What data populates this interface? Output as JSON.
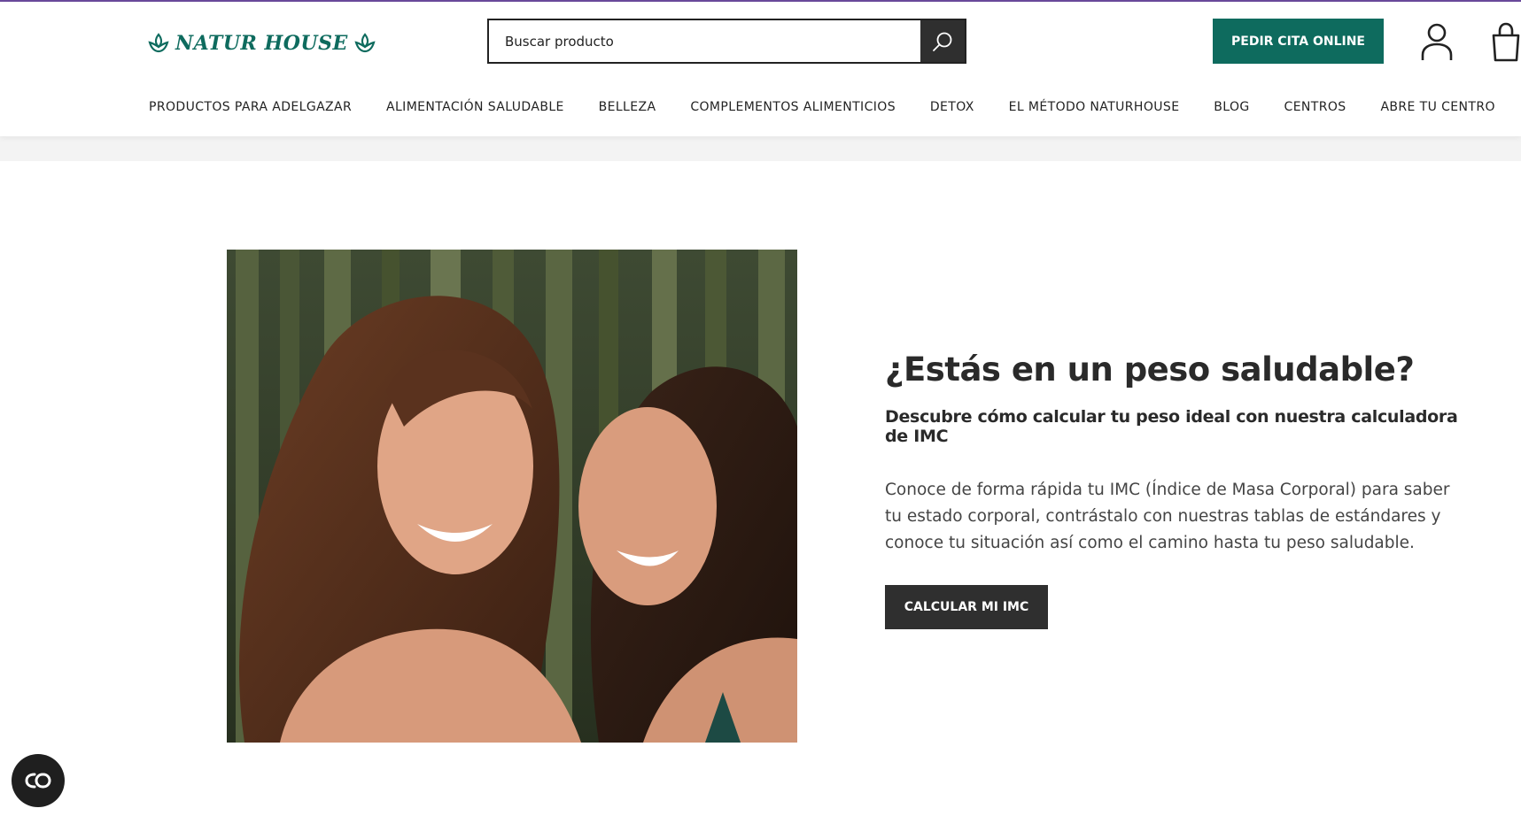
{
  "brand": {
    "logo_text": "NATUR HOUSE",
    "primary_color": "#0e6b5e",
    "dark_color": "#2f2f2f",
    "accent_line_color": "#6a4a9c"
  },
  "header": {
    "search": {
      "placeholder": "Buscar producto",
      "icon": "search-icon"
    },
    "appointment_button": "PEDIR CITA ONLINE",
    "user_icon": "user-icon",
    "cart_icon": "shopping-bag-icon"
  },
  "nav": {
    "items": [
      {
        "label": "PRODUCTOS PARA ADELGAZAR"
      },
      {
        "label": "ALIMENTACIÓN SALUDABLE"
      },
      {
        "label": "BELLEZA"
      },
      {
        "label": "COMPLEMENTOS ALIMENTICIOS"
      },
      {
        "label": "DETOX"
      },
      {
        "label": "EL MÉTODO NATURHOUSE"
      },
      {
        "label": "BLOG"
      },
      {
        "label": "CENTROS"
      },
      {
        "label": "ABRE TU CENTRO"
      }
    ]
  },
  "hero": {
    "title": "¿Estás en un peso saludable?",
    "subtitle": "Descubre cómo calcular tu peso ideal con nuestra calculadora de IMC",
    "body": "Conoce de forma rápida tu IMC (Índice de Masa Corporal) para saber tu estado corporal, contrástalo con nuestras tablas de estándares y conoce tu situación así como el camino hasta tu peso saludable.",
    "button": "CALCULAR MI IMC",
    "image": "two-smiling-women-bamboo-photo"
  },
  "accessibility": {
    "icon": "accessibility-icon"
  }
}
